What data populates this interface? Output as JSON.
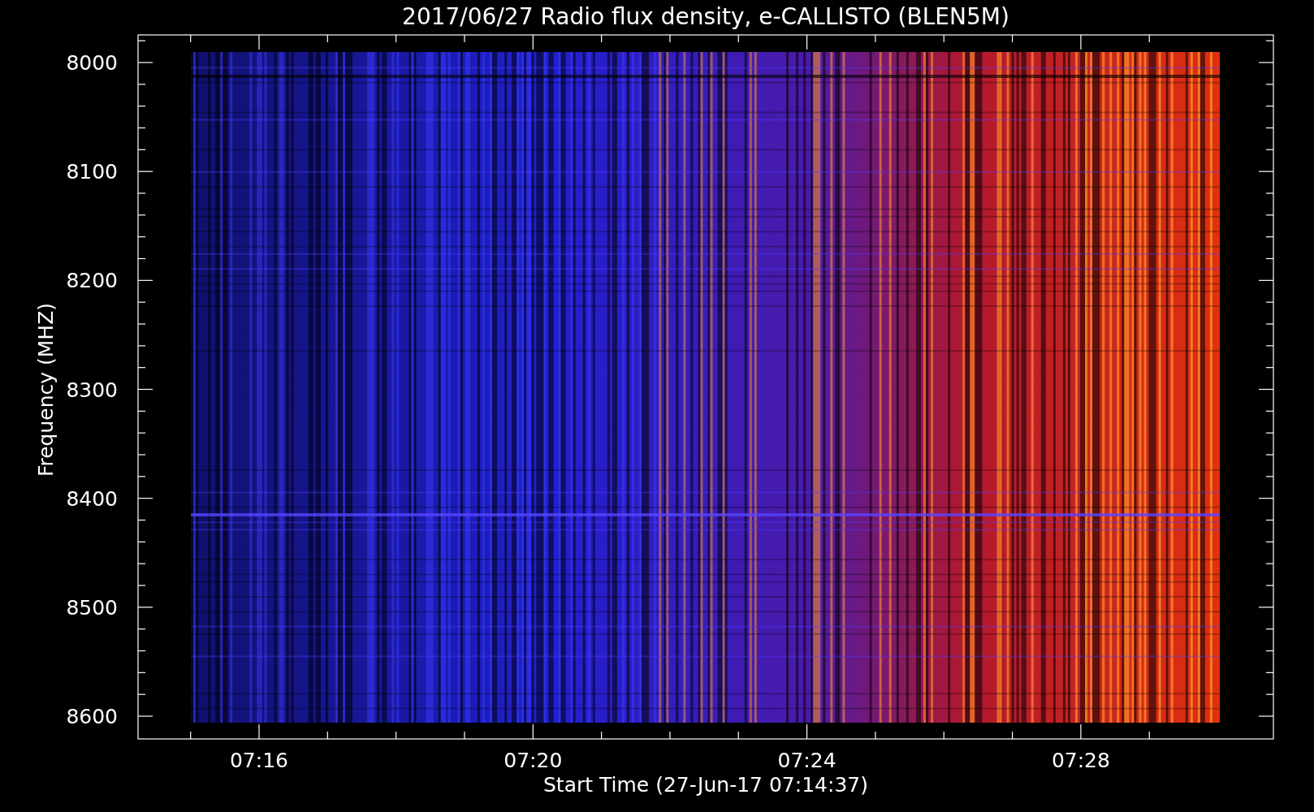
{
  "plot": {
    "title": "2017/06/27  Radio flux density, e-CALLISTO (BLEN5M)",
    "ylabel": "Frequency (MHZ)",
    "xlabel": "Start Time (27-Jun-17 07:14:37)",
    "yticks": [
      "8000",
      "8100",
      "8200",
      "8300",
      "8400",
      "8500",
      "8600"
    ],
    "xticks": [
      "07:16",
      "07:20",
      "07:24",
      "07:28"
    ]
  }
}
